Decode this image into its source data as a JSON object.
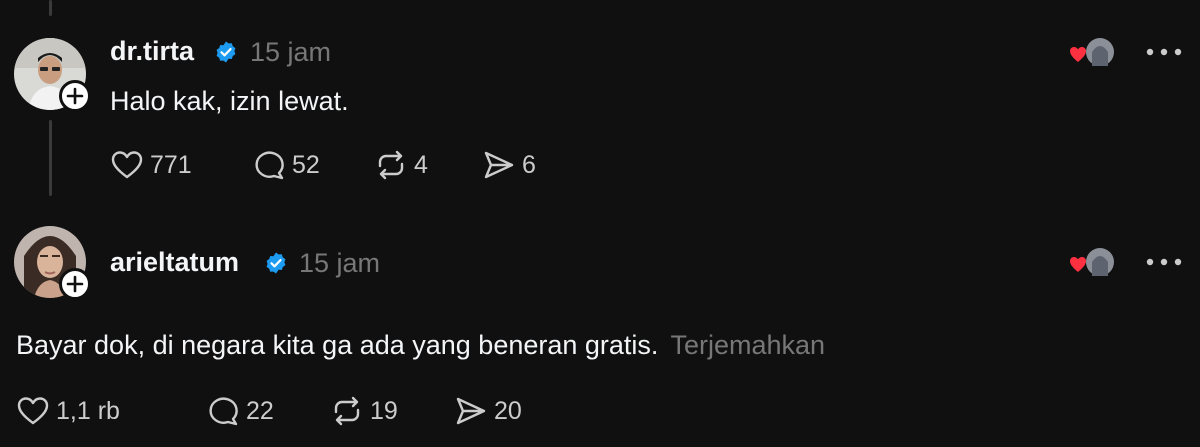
{
  "posts": [
    {
      "username": "dr.tirta",
      "time": "15 jam",
      "text": "Halo kak, izin lewat.",
      "translate": "",
      "likes": "771",
      "replies": "52",
      "reposts": "4",
      "shares": "6"
    },
    {
      "username": "arieltatum",
      "time": "15 jam",
      "text": "Bayar dok, di negara kita ga ada yang beneran gratis.",
      "translate": "Terjemahkan",
      "likes": "1,1 rb",
      "replies": "22",
      "reposts": "19",
      "shares": "20"
    }
  ],
  "colors": {
    "background": "#101010",
    "verified": "#1d9bf0",
    "heart": "#ff3040",
    "muted": "#777777"
  },
  "icons": [
    "verified-badge-icon",
    "heart-icon",
    "comment-icon",
    "repost-icon",
    "share-icon",
    "more-icon",
    "plus-icon"
  ]
}
